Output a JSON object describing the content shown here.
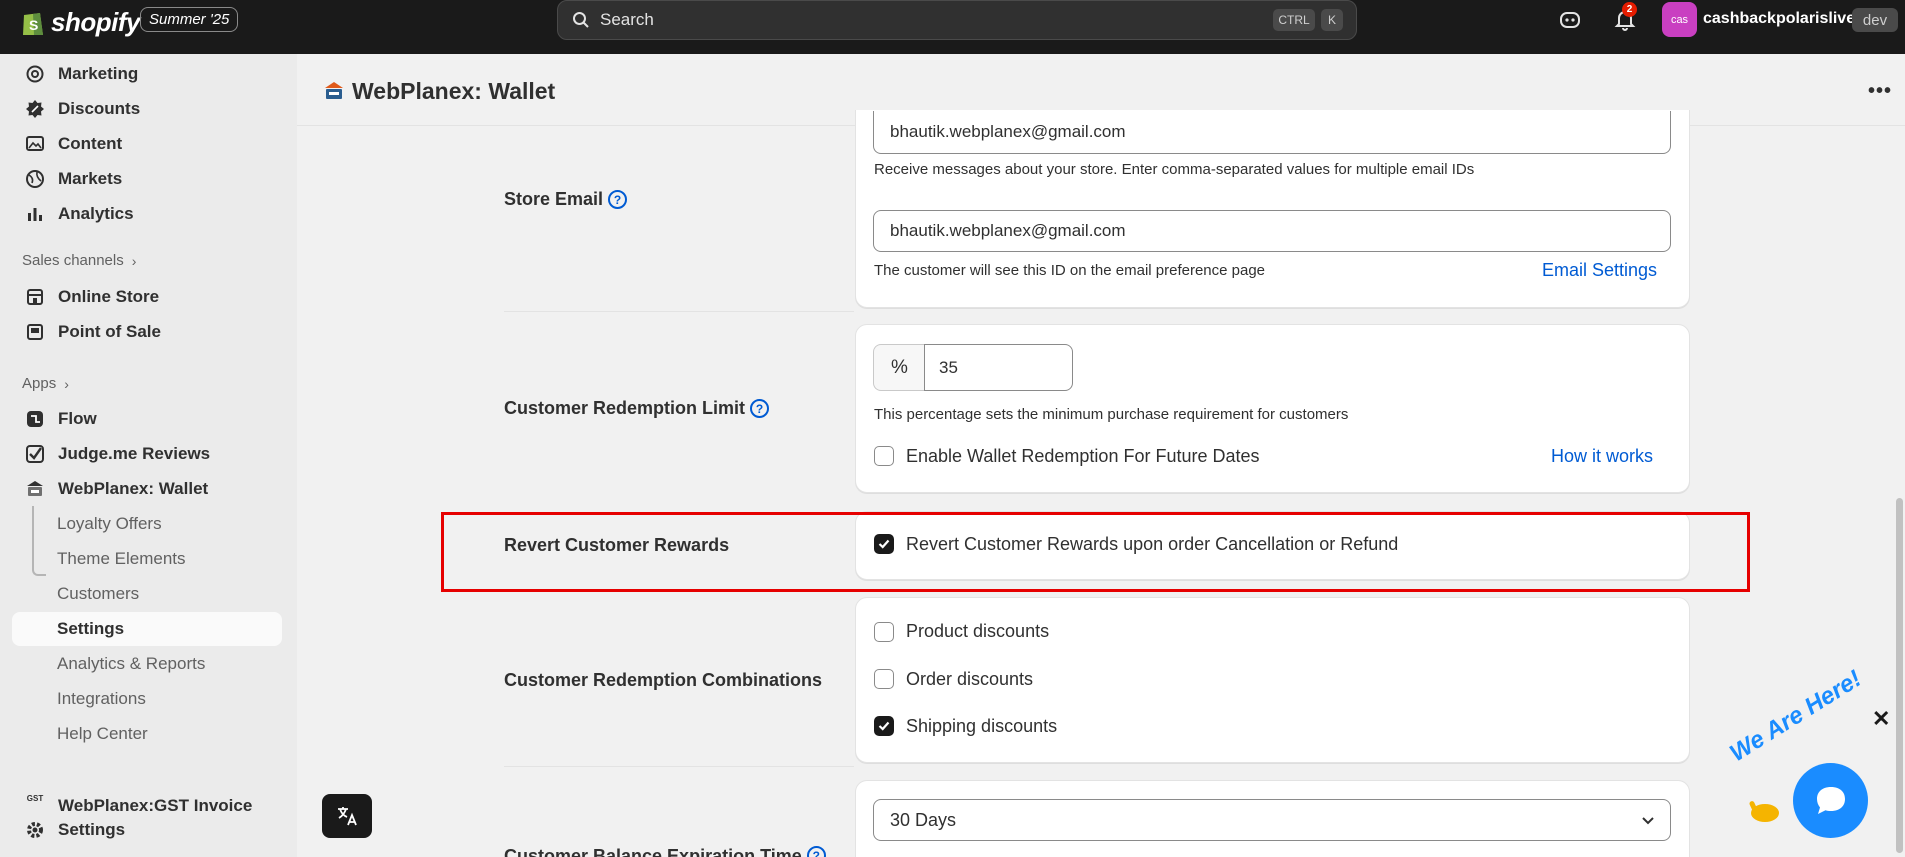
{
  "topbar": {
    "logo_text": "shopify",
    "edition": "Summer '25",
    "search_placeholder": "Search",
    "shortcut_ctrl": "CTRL",
    "shortcut_k": "K",
    "notification_count": "2",
    "avatar_initials": "cas",
    "store_name": "cashbackpolarislive",
    "store_badge": "dev"
  },
  "sidebar": {
    "items_top": [
      {
        "label": "Marketing",
        "icon": "target-icon"
      },
      {
        "label": "Discounts",
        "icon": "discount-icon"
      },
      {
        "label": "Content",
        "icon": "image-icon"
      },
      {
        "label": "Markets",
        "icon": "globe-icon"
      },
      {
        "label": "Analytics",
        "icon": "bar-chart-icon"
      }
    ],
    "sales_channels_label": "Sales channels",
    "sales_channels": [
      {
        "label": "Online Store",
        "icon": "store-icon"
      },
      {
        "label": "Point of Sale",
        "icon": "pos-icon"
      }
    ],
    "apps_label": "Apps",
    "apps": [
      {
        "label": "Flow",
        "icon": "flow-icon"
      },
      {
        "label": "Judge.me Reviews",
        "icon": "judgeme-icon"
      },
      {
        "label": "WebPlanex: Wallet",
        "icon": "wallet-app-icon"
      }
    ],
    "wallet_subitems": [
      "Loyalty Offers",
      "Theme Elements",
      "Customers",
      "Settings",
      "Analytics & Reports",
      "Integrations",
      "Help Center"
    ],
    "gst_app": "WebPlanex:GST Invoice",
    "gst_icon_text": "GST",
    "settings": "Settings"
  },
  "page": {
    "title": "WebPlanex: Wallet"
  },
  "store_email": {
    "label": "Store Email",
    "email_value_1": "bhautik.webplanex@gmail.com",
    "help_1": "Receive messages about your store. Enter comma-separated values for multiple email IDs",
    "email_value_2": "bhautik.webplanex@gmail.com",
    "help_2": "The customer will see this ID on the email preference page",
    "link": "Email Settings"
  },
  "redemption_limit": {
    "label": "Customer Redemption Limit",
    "prefix": "%",
    "value": "35",
    "help": "This percentage sets the minimum purchase requirement for customers",
    "checkbox_label": "Enable Wallet Redemption For Future Dates",
    "checked": false,
    "link": "How it works"
  },
  "revert_rewards": {
    "label": "Revert Customer Rewards",
    "checkbox_label": "Revert Customer Rewards upon order Cancellation or Refund",
    "checked": true
  },
  "combinations": {
    "label": "Customer Redemption Combinations",
    "options": [
      {
        "label": "Product discounts",
        "checked": false
      },
      {
        "label": "Order discounts",
        "checked": false
      },
      {
        "label": "Shipping discounts",
        "checked": true
      }
    ]
  },
  "expiration": {
    "label": "Customer Balance Expiration Time",
    "selected": "30 Days"
  },
  "chat_widget": {
    "tagline": "We Are Here!"
  },
  "colors": {
    "accent_link": "#005bd3",
    "highlight_border": "#e60000",
    "chat_blue": "#1a8cff"
  }
}
